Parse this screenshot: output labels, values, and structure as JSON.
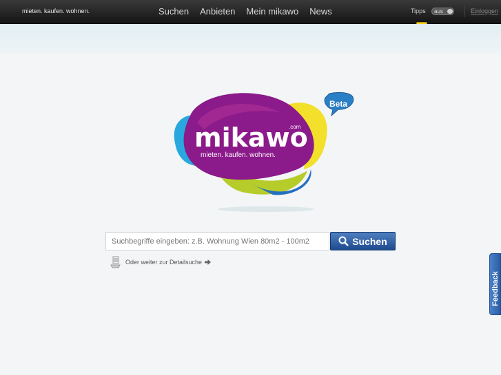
{
  "header": {
    "tagline": "mieten. kaufen. wohnen.",
    "nav": [
      "Suchen",
      "Anbieten",
      "Mein mikawo",
      "News"
    ],
    "tipps_label": "Tipps",
    "toggle_label": "aus",
    "login_label": "Einloggen"
  },
  "logo": {
    "brand": "mikawo",
    "domain": ".com",
    "slogan": "mieten. kaufen. wohnen.",
    "badge": "Beta"
  },
  "search": {
    "placeholder": "Suchbegriffe eingeben: z.B. Wohnung Wien 80m2 - 100m2",
    "button_label": "Suchen",
    "detail_link": "Oder weiter zur Detailsuche"
  },
  "feedback": {
    "label": "Feedback"
  },
  "colors": {
    "brand_purple": "#8b1a8a",
    "button_blue": "#2a5aa0",
    "badge_blue": "#2b7fc4",
    "tip_yellow": "#f2d323"
  }
}
